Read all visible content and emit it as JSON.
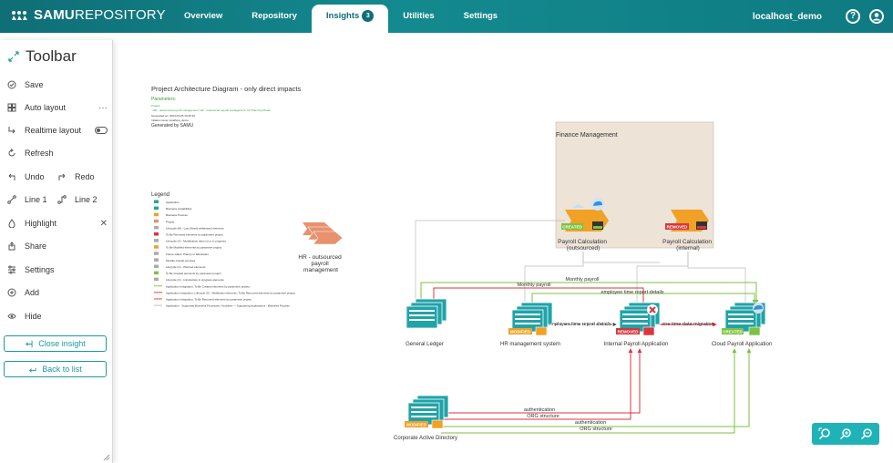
{
  "brand": {
    "name_bold": "SAMU",
    "name_light": "REPOSITORY"
  },
  "nav": {
    "items": [
      {
        "label": "Overview"
      },
      {
        "label": "Repository"
      },
      {
        "label": "Insights",
        "badge": "3",
        "active": true
      },
      {
        "label": "Utilities"
      },
      {
        "label": "Settings"
      }
    ],
    "user": "localhost_demo"
  },
  "toolbar": {
    "title": "Toolbar",
    "save": "Save",
    "auto_layout": "Auto layout",
    "auto_layout_more": "···",
    "realtime_layout": "Realtime layout",
    "refresh": "Refresh",
    "undo": "Undo",
    "redo": "Redo",
    "line1": "Line 1",
    "line2": "Line 2",
    "highlight": "Highlight",
    "highlight_clear": "✕",
    "share": "Share",
    "settings": "Settings",
    "add": "Add",
    "hide": "Hide",
    "close_insight": "Close insight",
    "back_to_list": "Back to list"
  },
  "diagram": {
    "title": "Project Architecture Diagram - only direct impacts",
    "parameters_label": "Parameters:",
    "params_line1": "Project:",
    "params_line2": "· HR - outsourced payroll management; HR - outsourced payroll management; CC Planning Phase",
    "params_line3": "Generated on: 2024-03-05 10:46:36",
    "params_line4": "Initiator name: localhost_demo",
    "generated_by": "Generated by SAMU",
    "legend_title": "Legend",
    "legend_items": [
      "Application",
      "Business Capabilities",
      "Business Process",
      "Project",
      "Lifecycle (M) - Lost (Newly withdrawn) elements",
      "To Be Removed elements by parameter project",
      "Lifecycle (X) - Modification (also in) or in progress",
      "To Be Modified elements by parameter project",
      "Future status: Plan(s) or Eliminates",
      "Module (Usual) services",
      "Lifecycle (C) - Planned elements",
      "To Be Created elements by parameter project",
      "Lifecycle (C) - Introduction in progress elements",
      "Application Integration; To Be Created elements by parameter project",
      "Application Integration; Lifecycle (X) - Withdrawn elements; To Be Removed elements by parameter project",
      "Application Integration; To Be Removed elements by parameter project",
      "Application - Supported Business Processes / Activities --- Supporting Applications - Business Process"
    ],
    "project_node": "HR - outsourced payroll management",
    "group_label": "Finance Management",
    "badges": {
      "created": "CREATED",
      "removed": "REMOVED",
      "modified": "MODIFIED"
    },
    "nodes": {
      "payroll_outsourced": "Payroll Calculation (outsourced)",
      "payroll_internal": "Payroll Calculation (internal)",
      "general_ledger": "General Ledger",
      "hr_system": "HR management system",
      "internal_payroll_app": "Internal Payroll Application",
      "cloud_payroll_app": "Cloud Payroll Application",
      "corporate_ad": "Corporate Active Directory"
    },
    "edges": {
      "monthly_payroll_1": "Monthly payroll",
      "monthly_payroll_2": "Monthly payroll",
      "employee_time_report_1": "employee time report details",
      "employee_time_report_2": "employee time report details",
      "one_time_migration": "one time data migration",
      "authentication_1": "authentication",
      "org_structure_1": "ORG structure",
      "authentication_2": "authentication",
      "org_structure_2": "ORG structure"
    },
    "colors": {
      "created": "#7ec242",
      "removed": "#d9363e",
      "modified": "#f0a126",
      "app": "#20a3a8",
      "group_bg": "#ede3d7"
    }
  },
  "zoom": {
    "icons": [
      "fit-icon",
      "zoom-in-icon",
      "zoom-out-icon"
    ]
  }
}
